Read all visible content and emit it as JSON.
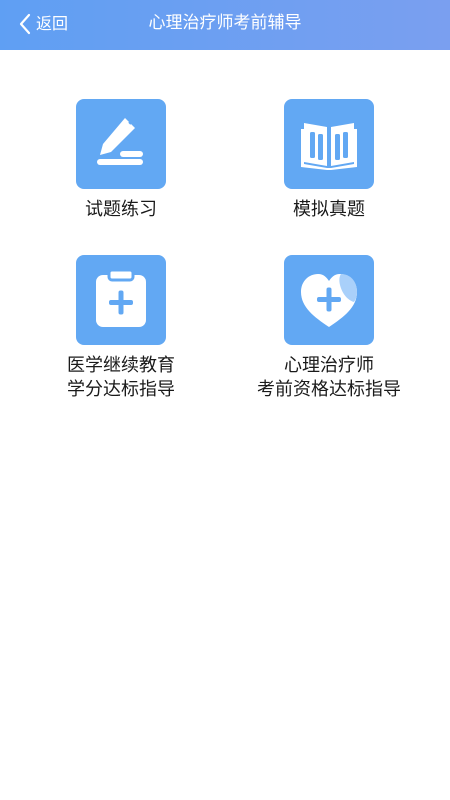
{
  "header": {
    "back_label": "返回",
    "title": "心理治疗师考前辅导"
  },
  "grid": {
    "items": [
      {
        "label": "试题练习",
        "icon": "pencil-write-icon"
      },
      {
        "label": "模拟真题",
        "icon": "open-book-icon"
      },
      {
        "label": "医学继续教育\n学分达标指导",
        "icon": "clipboard-plus-icon"
      },
      {
        "label": "心理治疗师\n考前资格达标指导",
        "icon": "heart-plus-icon"
      }
    ]
  },
  "colors": {
    "header_start": "#5f9ff3",
    "header_end": "#7a9ff0",
    "tile": "#62a8f3",
    "icon_fg": "#ffffff"
  }
}
